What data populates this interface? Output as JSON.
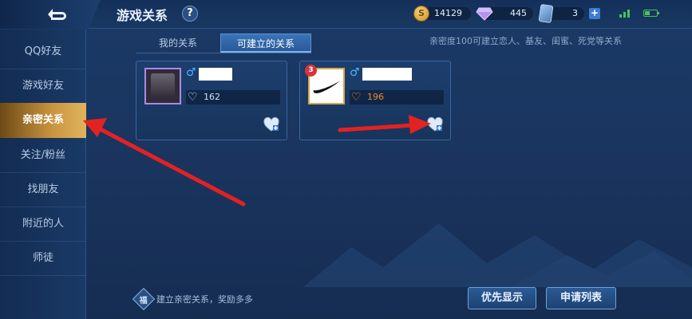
{
  "header": {
    "title": "游戏关系",
    "help_label": "?",
    "gold_coin": {
      "symbol": "S",
      "value": "14129"
    },
    "diamond_value": "445",
    "ticket_value": "3",
    "plus_label": "+"
  },
  "sidebar": {
    "items": [
      {
        "label": "QQ好友"
      },
      {
        "label": "游戏好友"
      },
      {
        "label": "亲密关系"
      },
      {
        "label": "关注/粉丝"
      },
      {
        "label": "找朋友"
      },
      {
        "label": "附近的人"
      },
      {
        "label": "师徒"
      }
    ],
    "active_index": 2
  },
  "tabs": [
    {
      "label": "我的关系"
    },
    {
      "label": "可建立的关系"
    }
  ],
  "hint_text": "亲密度100可建立恋人、基友、闺蜜、死党等关系",
  "friends": [
    {
      "gender_symbol": "♂",
      "intimacy": "162",
      "heart": "♡"
    },
    {
      "gender_symbol": "♂",
      "intimacy": "196",
      "heart": "♡",
      "level": "3"
    }
  ],
  "footer": {
    "reward_icon": "福",
    "reward_text": "建立亲密关系，奖励多多",
    "priority_button": "优先显示",
    "request_list_button": "申请列表"
  },
  "colors": {
    "accent_gold": "#c99440",
    "arrow_red": "#e32222",
    "intimacy_orange": "#f08a2a"
  }
}
